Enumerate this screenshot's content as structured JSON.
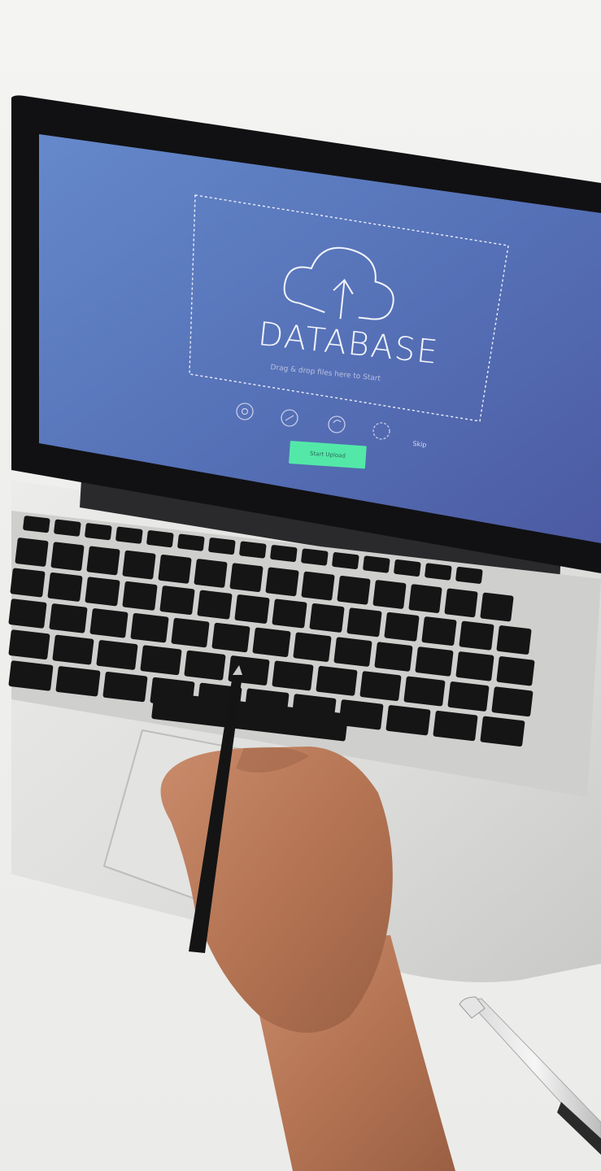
{
  "screen": {
    "title": "DATABASE",
    "subtitle": "Drag & drop files here to Start",
    "cta_label": "Start Upload",
    "skip_label": "Skip"
  },
  "colors": {
    "screen_top": "#5f86c8",
    "screen_bottom": "#4f5ea6",
    "accent_button": "#53e8a8",
    "laptop_silver": "#d9d9d7",
    "key_black": "#151516",
    "desk": "#efefed",
    "skin": "#b8795a"
  },
  "icons": [
    "cloud-upload-icon",
    "settings-icon",
    "share-icon",
    "sync-icon"
  ]
}
